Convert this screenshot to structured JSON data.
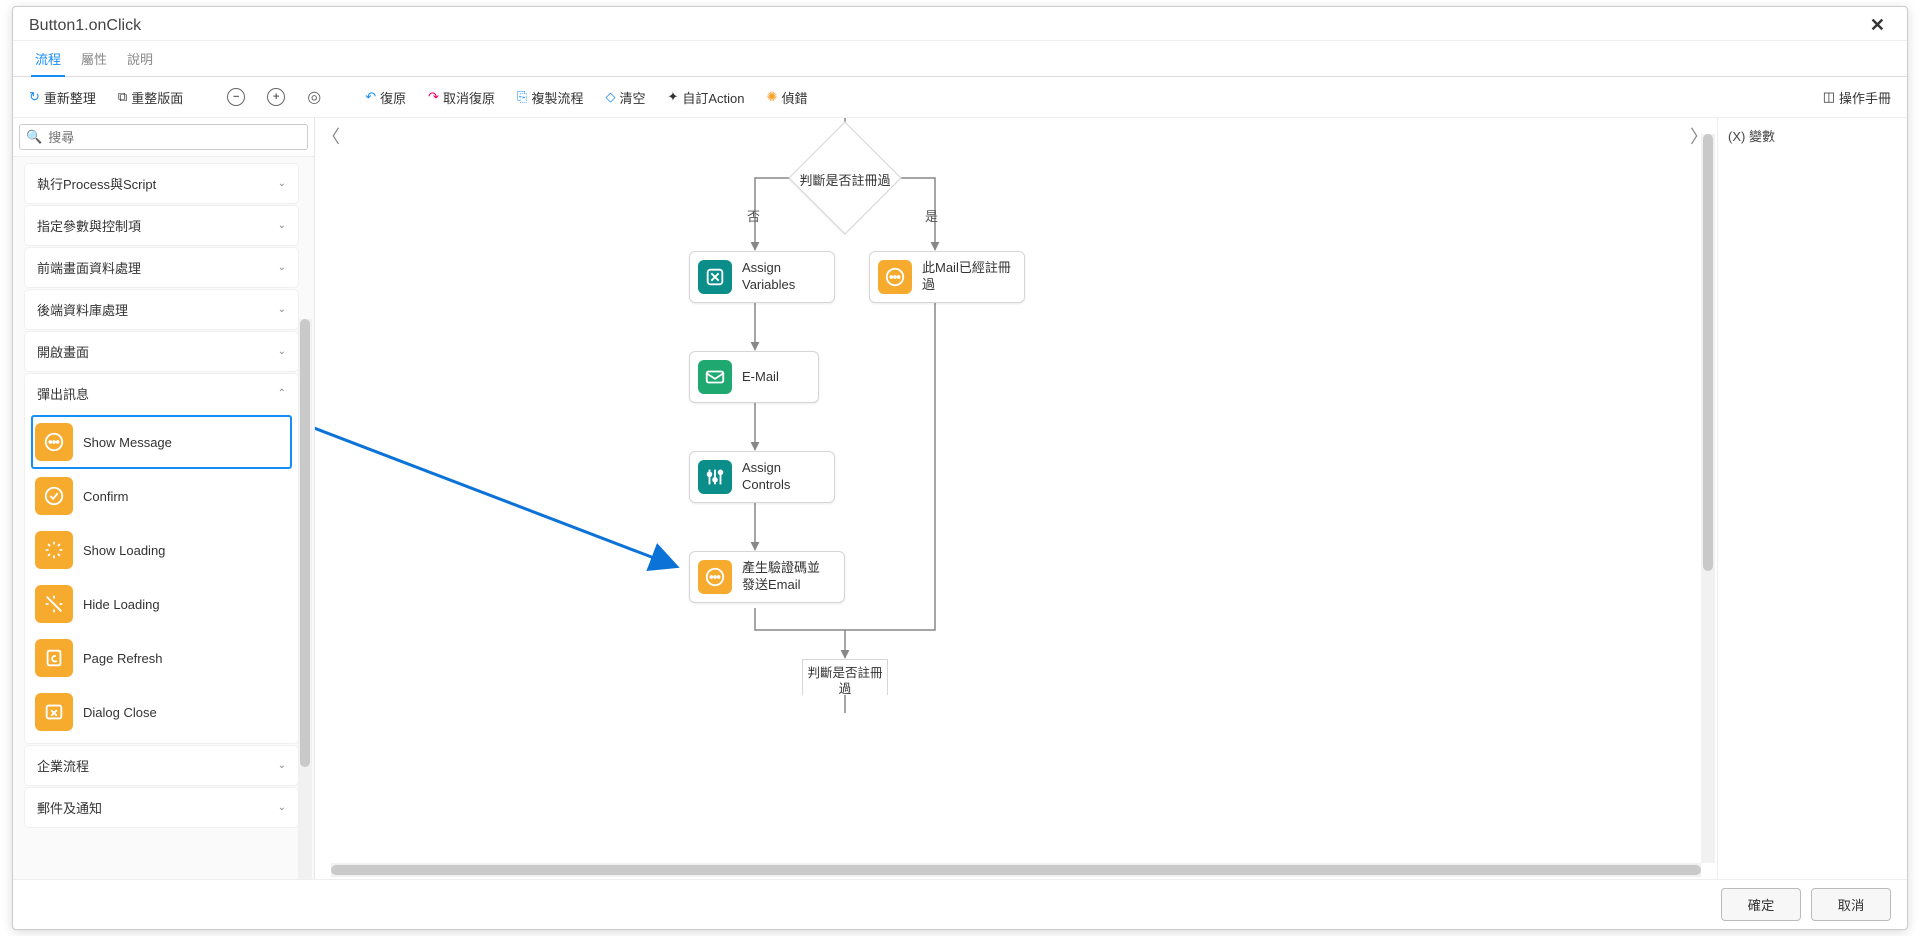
{
  "modal": {
    "title": "Button1.onClick"
  },
  "tabs": [
    {
      "label": "流程",
      "active": true
    },
    {
      "label": "屬性",
      "active": false
    },
    {
      "label": "說明",
      "active": false
    }
  ],
  "toolbar": {
    "refresh": "重新整理",
    "layout": "重整版面",
    "undo": "復原",
    "redo": "取消復原",
    "copy": "複製流程",
    "clear": "清空",
    "custom": "自訂Action",
    "debug": "偵錯",
    "manual": "操作手冊"
  },
  "search": {
    "placeholder": "搜尋"
  },
  "categories": [
    {
      "label": "執行Process與Script",
      "open": false
    },
    {
      "label": "指定參數與控制項",
      "open": false
    },
    {
      "label": "前端畫面資料處理",
      "open": false
    },
    {
      "label": "後端資料庫處理",
      "open": false
    },
    {
      "label": "開啟畫面",
      "open": false
    },
    {
      "label": "彈出訊息",
      "open": true,
      "items": [
        {
          "label": "Show Message",
          "selected": true,
          "icon": "message"
        },
        {
          "label": "Confirm",
          "icon": "confirm"
        },
        {
          "label": "Show Loading",
          "icon": "loading"
        },
        {
          "label": "Hide Loading",
          "icon": "hide"
        },
        {
          "label": "Page Refresh",
          "icon": "refresh"
        },
        {
          "label": "Dialog Close",
          "icon": "close"
        }
      ]
    },
    {
      "label": "企業流程",
      "open": false
    },
    {
      "label": "郵件及通知",
      "open": false
    }
  ],
  "flow": {
    "decision1": "判斷是否註冊過",
    "branch_no": "否",
    "branch_yes": "是",
    "node_assignvar": "Assign Variables",
    "node_mailreg": "此Mail已經註冊過",
    "node_email": "E-Mail",
    "node_assignctrl": "Assign Controls",
    "node_sendcode": "產生驗證碼並發送Email",
    "decision2": "判斷是否註冊過"
  },
  "rightPanel": {
    "title": "(X) 變數"
  },
  "footer": {
    "ok": "確定",
    "cancel": "取消"
  }
}
